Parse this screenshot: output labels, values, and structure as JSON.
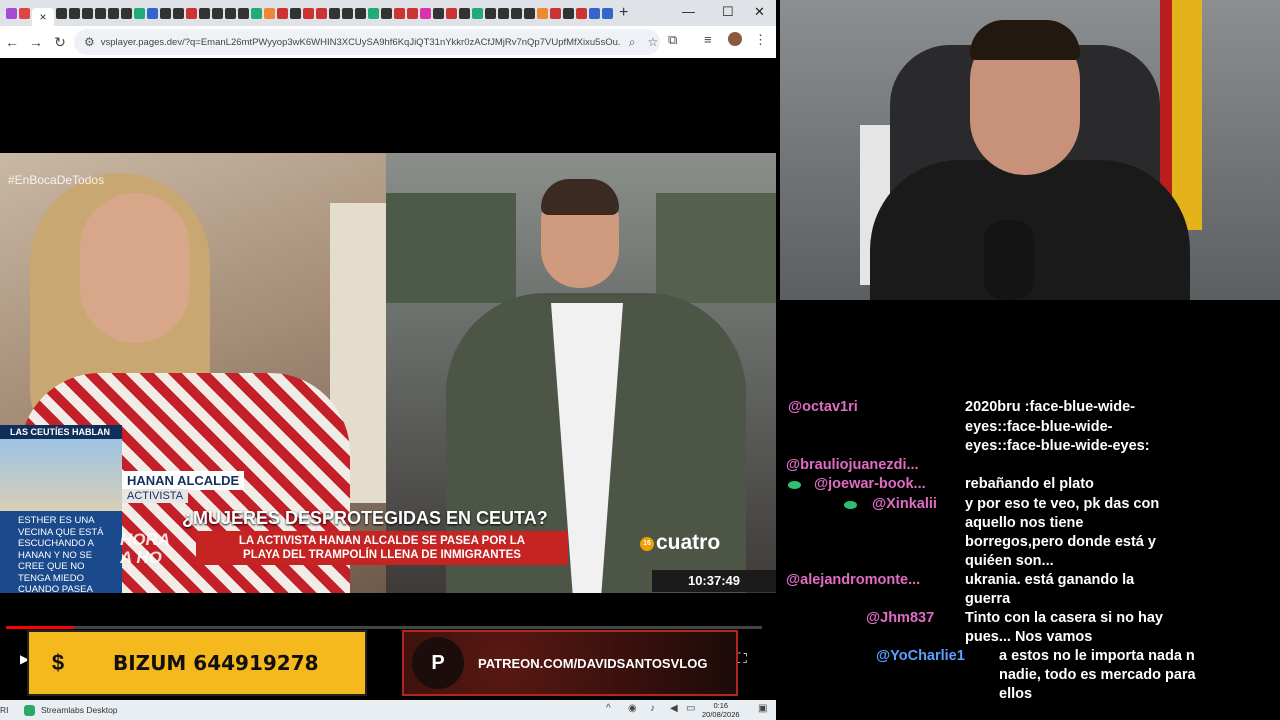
{
  "browser": {
    "new_tab": "+",
    "url": "vsplayer.pages.dev/?q=EmanL26mtPWyyop3wK6WHIN3XCUySA9hf6KqJiQT31nYkkr0zACfJMjRv7nQp7VUpfMfXixu5sOu...",
    "close_tab": "×"
  },
  "video": {
    "hashtag": "#EnBocaDeTodos",
    "ticker_title": "LAS CEUTÍES HABLAN",
    "ticker_text": "ESTHER ES UNA VECINA QUE ESTÁ ESCUCHANDO A HANAN Y NO SE CREE QUE NO TENGA MIEDO CUANDO PASEA POR CEUTA",
    "name": "HANAN ALCALDE",
    "role": "ACTIVISTA",
    "headline": "¿MUJERES DESPROTEGIDAS EN CEUTA?",
    "sub_line1": "LA ACTIVISTA HANAN ALCALDE SE PASEA POR LA",
    "sub_line2": "PLAYA DEL TRAMPOLÍN LLENA DE INMIGRANTES",
    "big_side": "HORA",
    "big_side2": "A HO",
    "channel_badge": "16",
    "channel": "cuatro",
    "clock": "10:37:49",
    "progress": 0.09
  },
  "overlays": {
    "bizum_icon": "$",
    "bizum": "BIZUM 644919278",
    "patreon": "PATREON.COM/DAVIDSANTOSVLOG"
  },
  "taskbar": {
    "app": "Streamlabs Desktop",
    "time": "0:16",
    "date": "20/08/2026",
    "left_text": "RI"
  },
  "chat": [
    {
      "name": "@octav1ri",
      "text": "2020bru :face-blue-wide-"
    },
    {
      "name": "",
      "text": "eyes::face-blue-wide-"
    },
    {
      "name": "",
      "text": "eyes::face-blue-wide-eyes:"
    },
    {
      "name": "@brauliojuanezdi...",
      "text": ""
    },
    {
      "name": "@joewar-book...",
      "text": "rebañando el plato"
    },
    {
      "name": "@Xinkalii",
      "text": "y por eso te veo, pk das con"
    },
    {
      "name": "",
      "text": "aquello nos tiene"
    },
    {
      "name": "",
      "text": "borregos,pero donde está y"
    },
    {
      "name": "",
      "text": "quiéen son..."
    },
    {
      "name": "@alejandromonte...",
      "text": "ukrania. está ganando la"
    },
    {
      "name": "",
      "text": "guerra"
    },
    {
      "name": "@Jhm837",
      "text": "Tinto con la casera si no hay"
    },
    {
      "name": "",
      "text": "pues... Nos vamos"
    },
    {
      "name": "@YoCharlie1",
      "text": "a estos no le importa nada n"
    },
    {
      "name": "",
      "text": "nadie, todo es mercado para"
    },
    {
      "name": "",
      "text": "ellos"
    }
  ],
  "colors": {
    "chat_name": "#e06cc4",
    "chat_name_blue": "#5aa0ff",
    "bizum_bg": "#f5b81d",
    "patreon_border": "#b3261e"
  }
}
